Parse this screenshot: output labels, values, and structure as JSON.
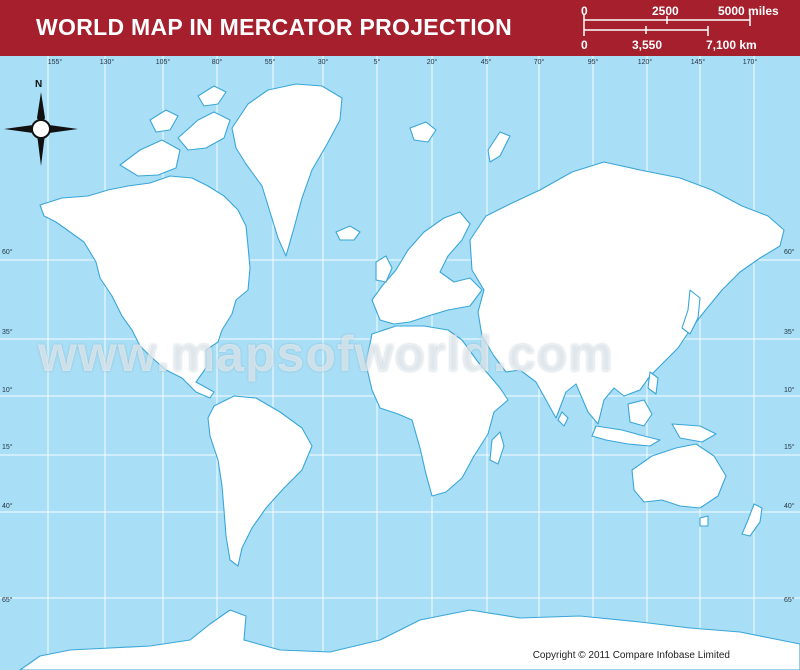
{
  "header": {
    "title": "WORLD MAP IN MERCATOR PROJECTION",
    "background_color": "#a51f2d"
  },
  "scale": {
    "miles": [
      "0",
      "2500",
      "5000 miles"
    ],
    "km": [
      "0",
      "3,550",
      "7,100 km"
    ]
  },
  "compass": {
    "north_label": "N"
  },
  "graticule": {
    "longitudes": [
      "155°",
      "130°",
      "105°",
      "80°",
      "55°",
      "30°",
      "5°",
      "20°",
      "45°",
      "70°",
      "95°",
      "120°",
      "145°",
      "170°"
    ],
    "latitudes_left": [
      "60°",
      "35°",
      "10°",
      "15°",
      "40°",
      "65°"
    ],
    "latitudes_right": [
      "60°",
      "35°",
      "10°",
      "15°",
      "40°",
      "65°"
    ]
  },
  "watermark": "www.mapsofworld.com",
  "copyright": "Copyright © 2011 Compare Infobase Limited",
  "colors": {
    "ocean": "#a8dff6",
    "land": "#ffffff",
    "coast": "#3aa6d8",
    "grid": "#ffffff"
  }
}
